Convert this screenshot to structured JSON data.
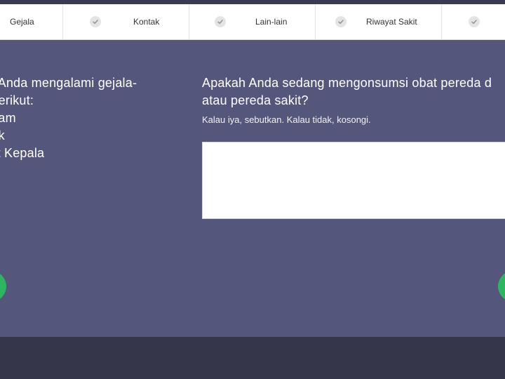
{
  "tabs": [
    {
      "label": "Gejala"
    },
    {
      "label": "Kontak"
    },
    {
      "label": "Lain-lain"
    },
    {
      "label": "Riwayat Sakit"
    }
  ],
  "left_question": {
    "text": "ah Anda mengalami gejala-\na berikut:",
    "symptoms": [
      "emam",
      "atuk",
      "akit Kepala"
    ]
  },
  "right_question": {
    "text": "Apakah Anda sedang mengonsumsi obat pereda d\natau pereda sakit?",
    "hint": "Kalau iya, sebutkan. Kalau tidak, kosongi.",
    "answer_value": ""
  },
  "icons": {
    "tab_check": "check-icon"
  },
  "colors": {
    "panel_bg": "#55567b",
    "nav_button": "#2fb562",
    "footer": "#35364a"
  }
}
